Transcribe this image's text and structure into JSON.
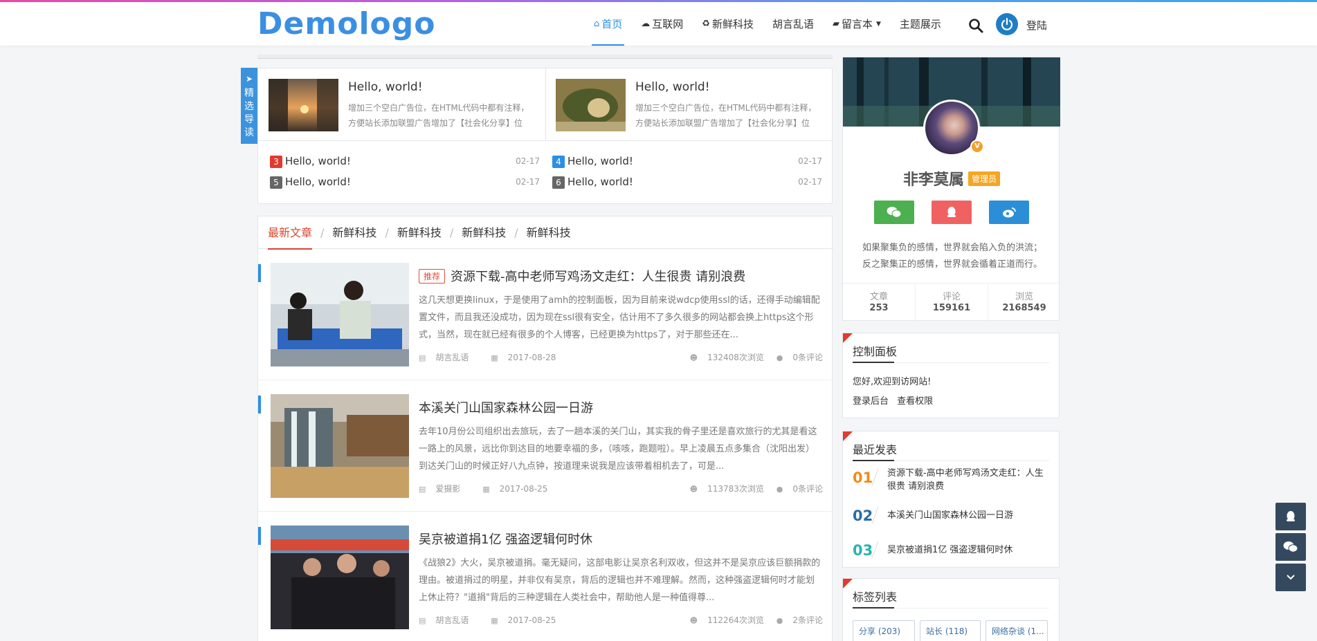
{
  "header": {
    "logo_text": "Demologo",
    "nav": [
      {
        "label": "首页",
        "icon": "home-icon",
        "active": true
      },
      {
        "label": "互联网",
        "icon": "cloud-icon"
      },
      {
        "label": "新鲜科技",
        "icon": "recycle-icon"
      },
      {
        "label": "胡言乱语"
      },
      {
        "label": "留言本",
        "icon": "book-icon",
        "dropdown": true
      },
      {
        "label": "主题展示"
      }
    ],
    "login_label": "登陆"
  },
  "featured": {
    "badge": "精选导读",
    "posts": [
      {
        "title": "Hello, world!",
        "excerpt": "增加三个空白广告位，在HTML代码中都有注释，方便站长添加联盟广告增加了【社会化分享】位"
      },
      {
        "title": "Hello, world!",
        "excerpt": "增加三个空白广告位，在HTML代码中都有注释，方便站长添加联盟广告增加了【社会化分享】位"
      }
    ],
    "rank_left": [
      {
        "num": "3",
        "title": "Hello, world!",
        "date": "02-17",
        "color": "#e23a2e"
      },
      {
        "num": "5",
        "title": "Hello, world!",
        "date": "02-17",
        "color": "#666666"
      }
    ],
    "rank_right": [
      {
        "num": "4",
        "title": "Hello, world!",
        "date": "02-17",
        "color": "#2b8fe3"
      },
      {
        "num": "6",
        "title": "Hello, world!",
        "date": "02-17",
        "color": "#666666"
      }
    ]
  },
  "tabs": [
    "最新文章",
    "新鲜科技",
    "新鲜科技",
    "新鲜科技",
    "新鲜科技"
  ],
  "posts": [
    {
      "tag": "推荐",
      "title": "资源下载-高中老师写鸡汤文走红：人生很贵 请别浪费",
      "excerpt": "这几天想更换linux，于是使用了amh的控制面板，因为目前来说wdcp使用ssl的话，还得手动编辑配置文件，而且我还没成功，因为现在ssl很有安全，估计用不了多久很多的网站都会换上https这个形式，当然，现在就已经有很多的个人博客，已经更换为https了，对于那些还在...",
      "category": "胡言乱语",
      "date": "2017-08-28",
      "views": "132408次浏览",
      "comments": "0条评论"
    },
    {
      "tag": "",
      "title": "本溪关门山国家森林公园一日游",
      "excerpt": "去年10月份公司组织出去旅玩，去了一趟本溪的关门山，其实我的骨子里还是喜欢旅行的尤其是看这一路上的风景，远比你到达目的地要幸福的多，（咳咳，跑题啦）。早上凌晨五点多集合（沈阳出发）到达关门山的时候正好八九点钟，按道理来说我是应该带着相机去了，可是...",
      "category": "爱摄影",
      "date": "2017-08-25",
      "views": "113783次浏览",
      "comments": "0条评论"
    },
    {
      "tag": "",
      "title": "吴京被道捐1亿 强盗逻辑何时休",
      "excerpt": "《战狼2》大火，吴京被道捐。毫无疑问，这部电影让吴京名利双收，但这并不是吴京应该巨额捐款的理由。被道捐过的明星，并非仅有吴京，背后的逻辑也并不难理解。然而，这种强盗逻辑何时才能划上休止符？\"道捐\"背后的三种逻辑在人类社会中，帮助他人是一种值得尊...",
      "category": "胡言乱语",
      "date": "2017-08-25",
      "views": "112264次浏览",
      "comments": "2条评论"
    }
  ],
  "profile": {
    "name": "非李莫属",
    "role": "管理员",
    "motto_1": "如果聚集负的感情，世界就会陷入负的洪流；",
    "motto_2": "反之聚集正的感情，世界就会循着正道而行。",
    "stats": [
      {
        "label": "文章",
        "value": "253"
      },
      {
        "label": "评论",
        "value": "159161"
      },
      {
        "label": "浏览",
        "value": "2168549"
      }
    ],
    "social_colors": {
      "wechat": "#4caf50",
      "qq": "#f06262",
      "weibo": "#2b8fd8"
    }
  },
  "control_panel": {
    "title": "控制面板",
    "welcome": "您好,欢迎到访网站!",
    "links": [
      "登录后台",
      "查看权限"
    ]
  },
  "recent": {
    "title": "最近发表",
    "items": [
      {
        "num": "01",
        "title": "资源下载-高中老师写鸡汤文走红：人生很贵 请别浪费",
        "color": "#f08c1a"
      },
      {
        "num": "02",
        "title": "本溪关门山国家森林公园一日游",
        "color": "#2a6ea6"
      },
      {
        "num": "03",
        "title": "吴京被道捐1亿 强盗逻辑何时休",
        "color": "#2bb3b0"
      }
    ]
  },
  "tag_list": {
    "title": "标签列表",
    "tags": [
      "分享 (203)",
      "站长 (118)",
      "网络杂谈 (1..."
    ]
  }
}
